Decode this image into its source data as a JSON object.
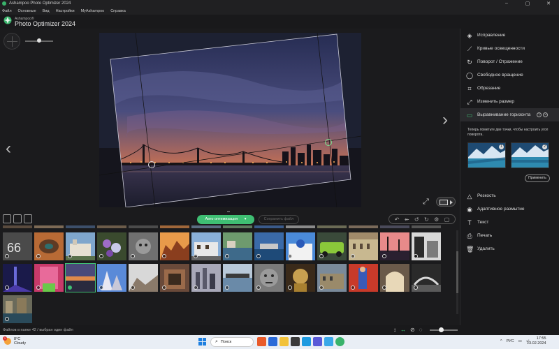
{
  "window": {
    "title": "Ashampoo Photo Optimizer 2024"
  },
  "menu": [
    "Файл",
    "Основные",
    "Вид",
    "Настройки",
    "MyAshampoo",
    "Справка"
  ],
  "header": {
    "brand": "Ashampoo®",
    "product": "Photo Optimizer 2024"
  },
  "toolbar": {
    "auto_label": "Авто оптимизация",
    "save_label": "Сохранить файл"
  },
  "tools_top": [
    {
      "label": "Исправление",
      "icon": "correction-icon",
      "glyph": "◈"
    },
    {
      "label": "Кривые освещенности",
      "icon": "curves-icon",
      "glyph": "⟋"
    },
    {
      "label": "Поворот / Отражение",
      "icon": "rotate-icon",
      "glyph": "↻"
    },
    {
      "label": "Свободное вращение",
      "icon": "free-rotate-icon",
      "glyph": "◯"
    },
    {
      "label": "Обрезание",
      "icon": "crop-icon",
      "glyph": "⌗"
    },
    {
      "label": "Изменить размер",
      "icon": "resize-icon",
      "glyph": "⤢"
    },
    {
      "label": "Выравнивание горизонта",
      "icon": "horizon-icon",
      "glyph": "▭"
    }
  ],
  "horizon": {
    "hint": "Теперь пометьте две точки, чтобы настроить угол поворота.",
    "badge_1": "1",
    "badge_2": "2",
    "apply_label": "Применить",
    "help": "?",
    "close": "×"
  },
  "tools_bottom": [
    {
      "label": "Резкость",
      "icon": "sharpen-icon",
      "glyph": "△"
    },
    {
      "label": "Адаптивное размытие",
      "icon": "blur-icon",
      "glyph": "◉"
    },
    {
      "label": "Текст",
      "icon": "text-icon",
      "glyph": "T"
    },
    {
      "label": "Печать",
      "icon": "print-icon",
      "glyph": "⎙"
    },
    {
      "label": "Удалить",
      "icon": "delete-icon",
      "glyph": "🗑"
    }
  ],
  "status": {
    "text": "Файлов в папке 42 / выбран один файл"
  },
  "taskbar": {
    "temp": "8°C",
    "weather": "Cloudy",
    "weather_badge": "1",
    "search": "Поиск",
    "lang": "РУС",
    "time": "17:55",
    "date": "13.02.2024"
  },
  "colors": {
    "accent": "#3fbf73",
    "background": "#1b1b1d",
    "panel": "#19191b"
  }
}
